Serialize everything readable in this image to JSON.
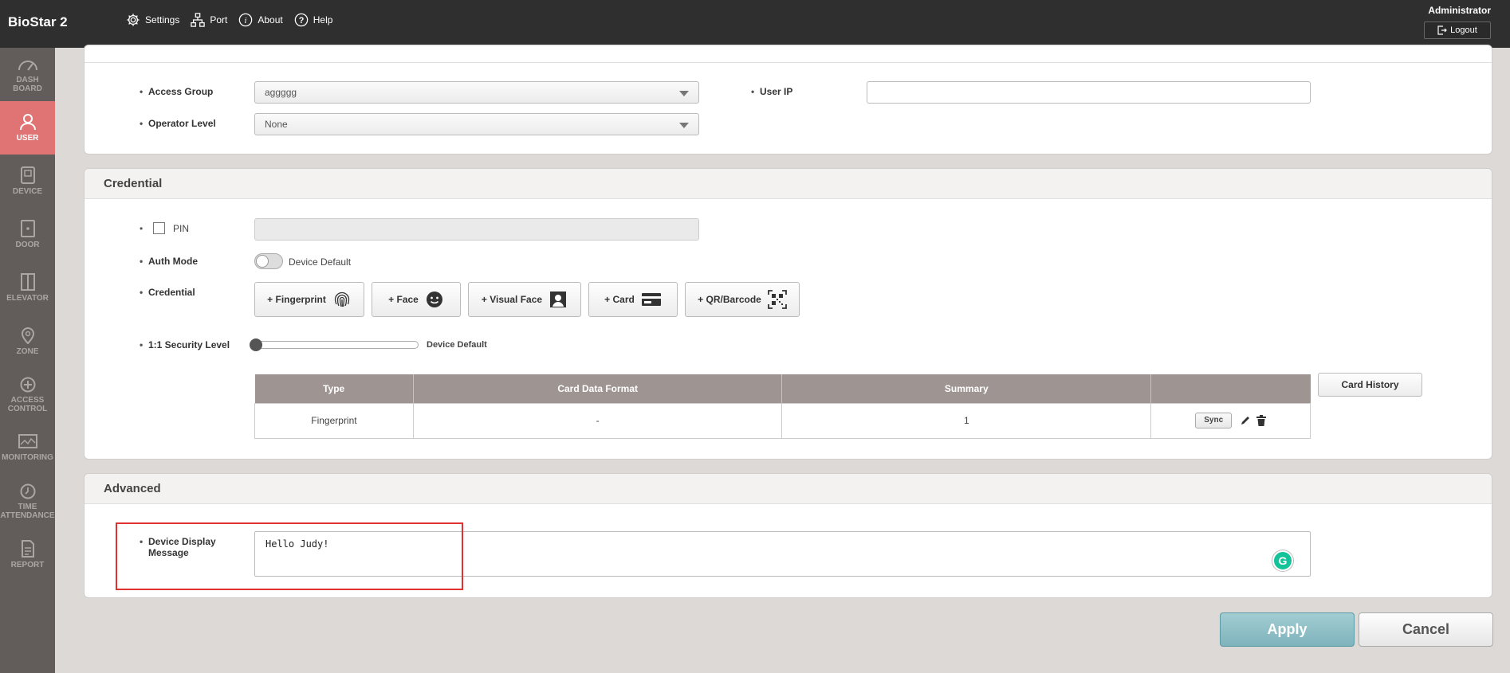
{
  "app": {
    "brand": "BioStar 2"
  },
  "topnav": [
    {
      "label": "Settings",
      "icon": "gear-icon"
    },
    {
      "label": "Port",
      "icon": "network-icon"
    },
    {
      "label": "About",
      "icon": "info-icon"
    },
    {
      "label": "Help",
      "icon": "help-icon"
    }
  ],
  "user": {
    "name": "Administrator",
    "logout_label": "Logout"
  },
  "sidebar": {
    "items": [
      {
        "label": "DASH\nBOARD",
        "icon": "dashboard-icon",
        "active": false
      },
      {
        "label": "USER",
        "icon": "user-icon",
        "active": true
      },
      {
        "label": "DEVICE",
        "icon": "device-icon",
        "active": false
      },
      {
        "label": "DOOR",
        "icon": "door-icon",
        "active": false
      },
      {
        "label": "ELEVATOR",
        "icon": "elevator-icon",
        "active": false
      },
      {
        "label": "ZONE",
        "icon": "zone-icon",
        "active": false
      },
      {
        "label": "ACCESS\nCONTROL",
        "icon": "access-control-icon",
        "active": false
      },
      {
        "label": "MONITORING",
        "icon": "monitoring-icon",
        "active": false
      },
      {
        "label": "TIME\nATTENDANCE",
        "icon": "clock-icon",
        "active": false
      },
      {
        "label": "REPORT",
        "icon": "report-icon",
        "active": false
      }
    ]
  },
  "permission": {
    "access_group_label": "Access Group",
    "access_group_value": "aggggg",
    "operator_level_label": "Operator Level",
    "operator_level_value": "None",
    "user_ip_label": "User IP",
    "user_ip_value": ""
  },
  "credential": {
    "title": "Credential",
    "pin_label": "PIN",
    "auth_mode_label": "Auth Mode",
    "auth_mode_value": "Device Default",
    "credential_label": "Credential",
    "buttons": {
      "fingerprint": "+ Fingerprint",
      "face": "+ Face",
      "visual_face": "+ Visual Face",
      "card": "+ Card",
      "qr": "+ QR/Barcode"
    },
    "security_level_label": "1:1 Security Level",
    "security_level_value": "Device Default",
    "table": {
      "headers": {
        "type": "Type",
        "format": "Card Data Format",
        "summary": "Summary"
      },
      "rows": [
        {
          "type": "Fingerprint",
          "format": "-",
          "summary": "1",
          "sync": "Sync"
        }
      ]
    },
    "card_history_label": "Card History"
  },
  "advanced": {
    "title": "Advanced",
    "display_message_label_line1": "Device Display",
    "display_message_label_line2": "Message",
    "display_message_value": "Hello Judy!"
  },
  "actions": {
    "apply": "Apply",
    "cancel": "Cancel"
  },
  "colors": {
    "topbar": "#2f2f2f",
    "sidebar": "#625d5a",
    "sidebar_active": "#e07474",
    "table_header": "#9e9592",
    "apply": "#8fc0c7",
    "highlight": "#e03030"
  }
}
